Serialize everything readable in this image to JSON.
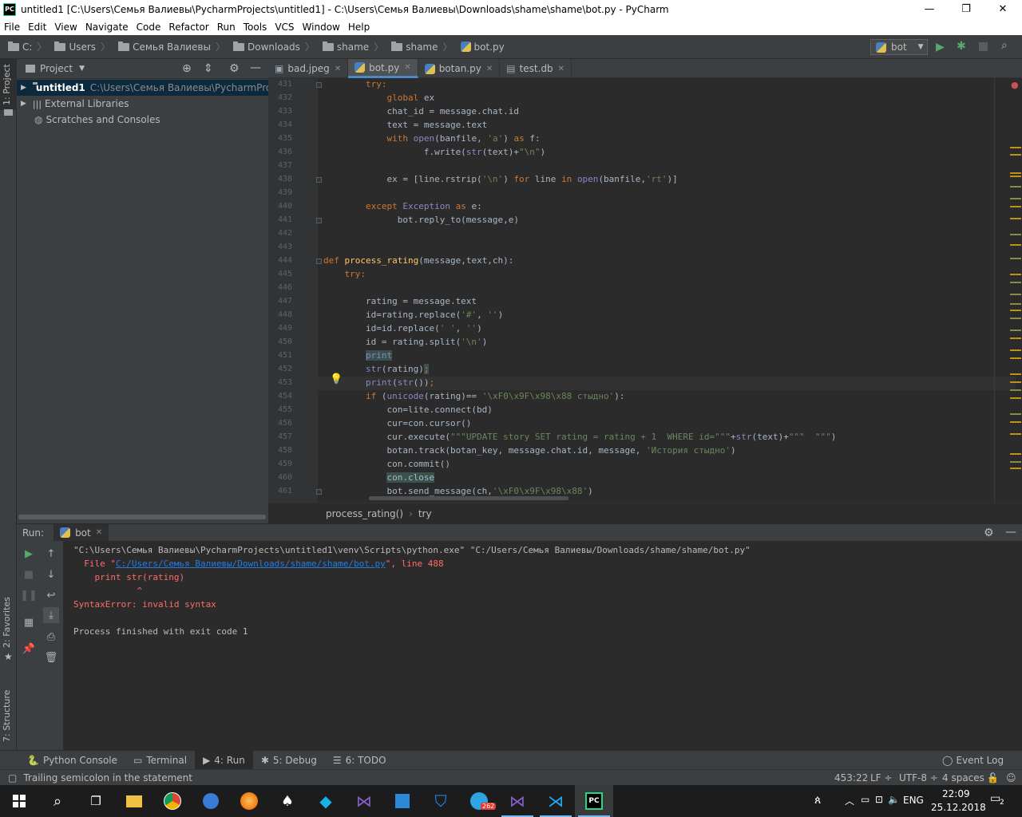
{
  "window": {
    "title": "untitled1 [C:\\Users\\Семья Валиевы\\PycharmProjects\\untitled1] - C:\\Users\\Семья Валиевы\\Downloads\\shame\\shame\\bot.py - PyCharm",
    "app_icon": "PC"
  },
  "menu": [
    "File",
    "Edit",
    "View",
    "Navigate",
    "Code",
    "Refactor",
    "Run",
    "Tools",
    "VCS",
    "Window",
    "Help"
  ],
  "navbar": {
    "crumbs": [
      "C:",
      "Users",
      "Семья Валиевы",
      "Downloads",
      "shame",
      "shame",
      "bot.py"
    ],
    "run_config": "bot"
  },
  "left_tool_windows": {
    "project": "1: Project",
    "favorites": "2: Favorites",
    "structure": "7: Structure"
  },
  "project_panel": {
    "title": "Project",
    "items": [
      {
        "label": "untitled1",
        "path": "C:\\Users\\Семья Валиевы\\PycharmProjec"
      },
      {
        "label": "External Libraries"
      },
      {
        "label": "Scratches and Consoles"
      }
    ]
  },
  "tabs": [
    "bad.jpeg",
    "bot.py",
    "botan.py",
    "test.db"
  ],
  "active_tab": "bot.py",
  "editor": {
    "line_numbers": [
      "431",
      "432",
      "433",
      "434",
      "435",
      "436",
      "437",
      "438",
      "439",
      "440",
      "441",
      "442",
      "443",
      "444",
      "445",
      "446",
      "447",
      "448",
      "449",
      "450",
      "451",
      "452",
      "453",
      "454",
      "455",
      "456",
      "457",
      "458",
      "459",
      "460",
      "461"
    ],
    "breadcrumb": [
      "process_rating()",
      "try"
    ]
  },
  "run_panel": {
    "label": "Run:",
    "tab": "bot",
    "lines": [
      "\"C:\\Users\\Семья Валиевы\\PycharmProjects\\untitled1\\venv\\Scripts\\python.exe\" \"C:/Users/Семья Валиевы/Downloads/shame/shame/bot.py\"",
      "  File \"",
      "C:/Users/Семья Валиевы/Downloads/shame/shame/bot.py",
      "\", line 488",
      "    print str(rating)",
      "            ^",
      "SyntaxError: invalid syntax",
      "Process finished with exit code 1"
    ]
  },
  "bottom_tabs": [
    "Python Console",
    "Terminal",
    "4: Run",
    "5: Debug",
    "6: TODO"
  ],
  "event_log": "Event Log",
  "status": {
    "message": "Trailing semicolon in the statement",
    "position": "453:22",
    "line_sep": "LF ÷",
    "encoding": "UTF-8 ÷",
    "indent": "4 spaces ÷"
  },
  "taskbar": {
    "lang": "ENG",
    "time": "22:09",
    "date": "25.12.2018",
    "telegram_badge": "262",
    "notifications": "2"
  },
  "colors": {
    "keyword": "#cc7832",
    "function": "#ffc66d",
    "string": "#6a8759",
    "builtin": "#8888c6",
    "error": "#ff6b68",
    "link": "#287bde"
  }
}
